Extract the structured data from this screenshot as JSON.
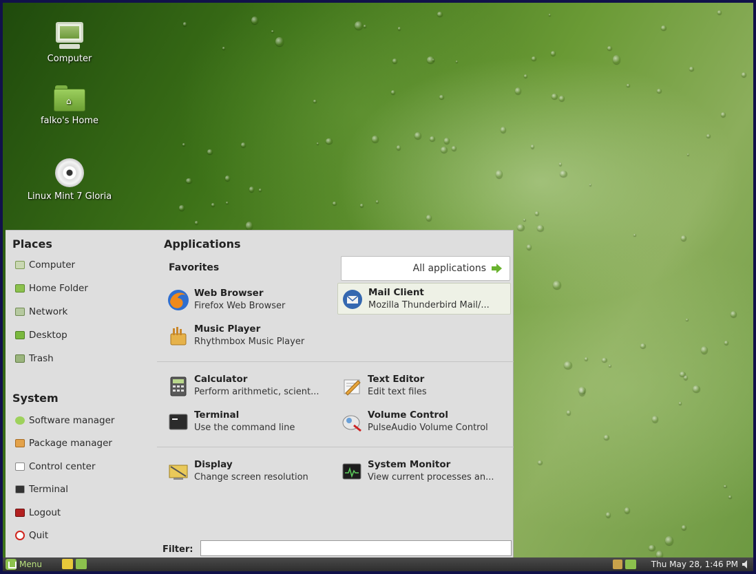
{
  "desktop": {
    "icons": [
      {
        "label": "Computer",
        "icon": "computer-icon"
      },
      {
        "label": "falko's Home",
        "icon": "home-folder-icon"
      },
      {
        "label": "Linux Mint 7 Gloria",
        "icon": "cd-disc-icon"
      }
    ]
  },
  "menu": {
    "places_title": "Places",
    "places": [
      {
        "label": "Computer",
        "icon": "computer-icon"
      },
      {
        "label": "Home Folder",
        "icon": "folder-icon"
      },
      {
        "label": "Network",
        "icon": "network-icon"
      },
      {
        "label": "Desktop",
        "icon": "desktop-icon"
      },
      {
        "label": "Trash",
        "icon": "trash-icon"
      }
    ],
    "system_title": "System",
    "system": [
      {
        "label": "Software manager",
        "icon": "software-manager-icon"
      },
      {
        "label": "Package manager",
        "icon": "package-manager-icon"
      },
      {
        "label": "Control center",
        "icon": "control-center-icon"
      },
      {
        "label": "Terminal",
        "icon": "terminal-icon"
      },
      {
        "label": "Logout",
        "icon": "logout-icon"
      },
      {
        "label": "Quit",
        "icon": "quit-icon"
      }
    ],
    "applications_title": "Applications",
    "favorites_title": "Favorites",
    "all_applications": "All applications",
    "apps": [
      {
        "name": "Web Browser",
        "desc": "Firefox Web Browser",
        "icon": "firefox-icon"
      },
      {
        "name": "Mail Client",
        "desc": "Mozilla Thunderbird Mail/...",
        "icon": "thunderbird-icon"
      },
      {
        "name": "Music Player",
        "desc": "Rhythmbox Music Player",
        "icon": "rhythmbox-icon"
      },
      {
        "name": "Calculator",
        "desc": "Perform arithmetic, scient...",
        "icon": "calculator-icon"
      },
      {
        "name": "Text Editor",
        "desc": "Edit text files",
        "icon": "text-editor-icon"
      },
      {
        "name": "Terminal",
        "desc": "Use the command line",
        "icon": "terminal-icon"
      },
      {
        "name": "Volume Control",
        "desc": "PulseAudio Volume Control",
        "icon": "volume-control-icon"
      },
      {
        "name": "Display",
        "desc": "Change screen resolution",
        "icon": "display-icon"
      },
      {
        "name": "System Monitor",
        "desc": "View current processes an...",
        "icon": "system-monitor-icon"
      }
    ],
    "filter_label": "Filter:",
    "filter_value": ""
  },
  "taskbar": {
    "menu_label": "Menu",
    "clock": "Thu May 28,  1:46 PM"
  },
  "colors": {
    "accent": "#69b22e",
    "menu_bg": "#dedede",
    "panel_bg": "#3a3a3a",
    "border": "#11114a"
  }
}
